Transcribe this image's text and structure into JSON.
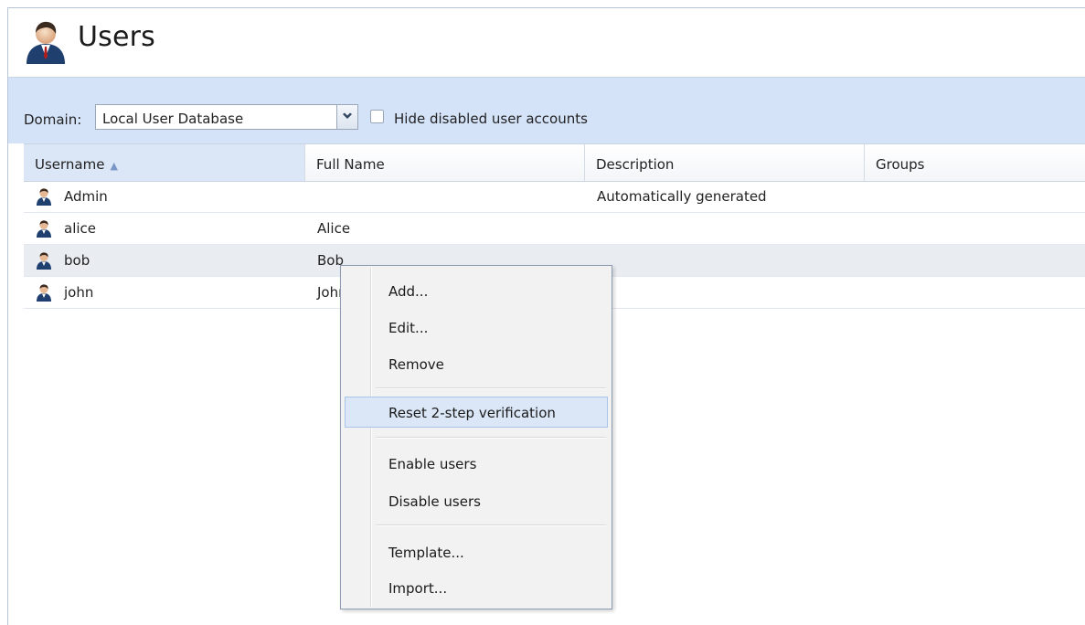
{
  "header": {
    "title": "Users",
    "icon": "user-icon"
  },
  "toolbar": {
    "domain_label": "Domain:",
    "domain_value": "Local User Database",
    "hide_disabled_label": "Hide disabled user accounts",
    "hide_disabled_checked": false
  },
  "grid": {
    "columns": [
      {
        "label": "Username",
        "sorted": "ascending"
      },
      {
        "label": "Full Name"
      },
      {
        "label": "Description"
      },
      {
        "label": "Groups"
      }
    ],
    "rows": [
      {
        "username": "Admin",
        "full_name": "",
        "description": "Automatically generated",
        "groups": ""
      },
      {
        "username": "alice",
        "full_name": "Alice",
        "description": "",
        "groups": ""
      },
      {
        "username": "bob",
        "full_name": "Bob",
        "description": "",
        "groups": "",
        "selected": true
      },
      {
        "username": "john",
        "full_name": "John",
        "description": "",
        "groups": ""
      }
    ]
  },
  "context_menu": {
    "items": [
      {
        "label": "Add..."
      },
      {
        "label": "Edit..."
      },
      {
        "label": "Remove"
      },
      {
        "label": "Reset 2-step verification",
        "highlighted": true
      },
      {
        "label": "Enable users"
      },
      {
        "label": "Disable users"
      },
      {
        "label": "Template..."
      },
      {
        "label": "Import..."
      }
    ]
  },
  "colors": {
    "toolbar_bg": "#d5e3f9",
    "menu_highlight": "#dbe7f7",
    "selected_row": "#e9edf2"
  }
}
